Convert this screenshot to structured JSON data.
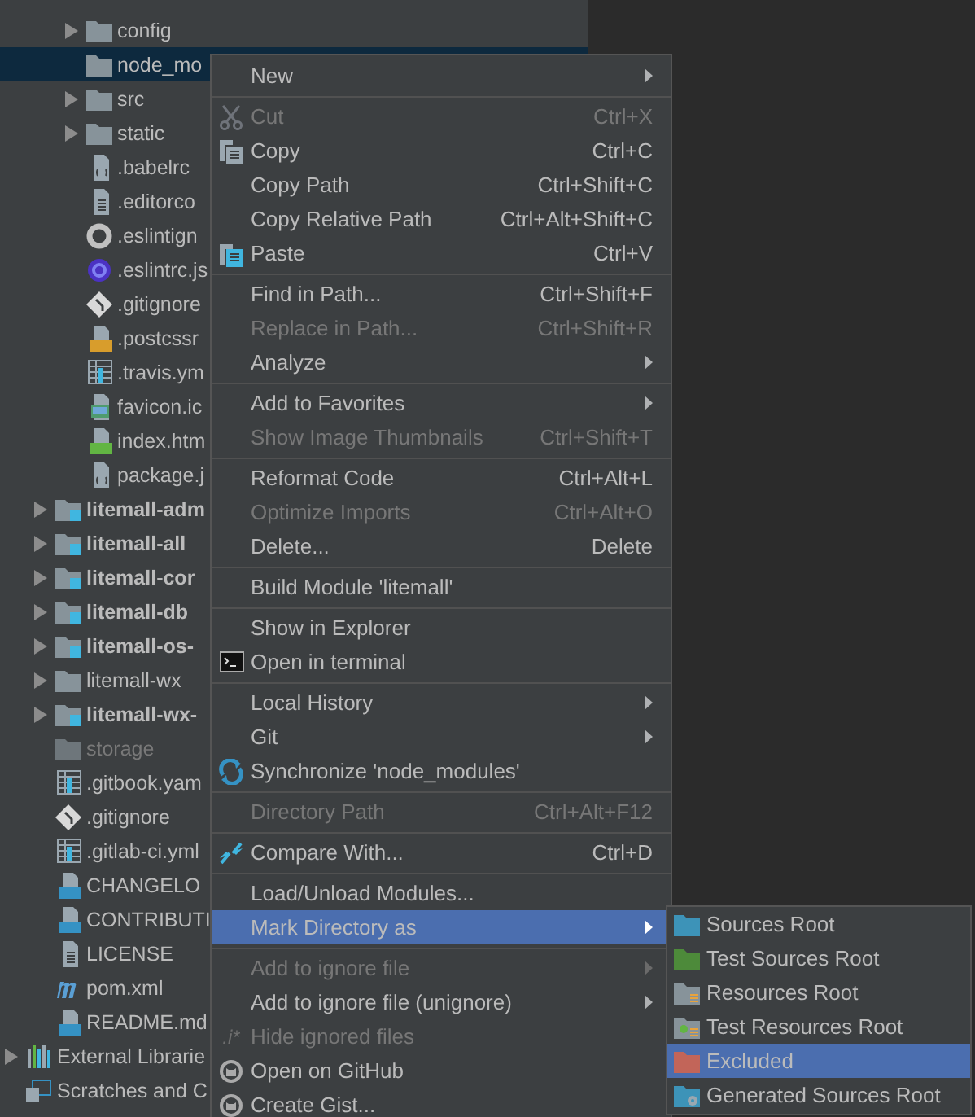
{
  "project_tree": [
    {
      "label": "config",
      "kind": "folder",
      "collapsed": true,
      "selected": false
    },
    {
      "label": "node_mo",
      "kind": "folder",
      "collapsed": false,
      "selected": true
    },
    {
      "label": "src",
      "kind": "folder",
      "collapsed": true,
      "selected": false
    },
    {
      "label": "static",
      "kind": "folder",
      "collapsed": true,
      "selected": false
    },
    {
      "label": ".babelrc",
      "kind": "babel",
      "collapsed": false,
      "selected": false
    },
    {
      "label": ".editorco",
      "kind": "text",
      "collapsed": false,
      "selected": false
    },
    {
      "label": ".eslintign",
      "kind": "ignore",
      "collapsed": false,
      "selected": false
    },
    {
      "label": ".eslintrc.js",
      "kind": "eslint",
      "collapsed": false,
      "selected": false
    },
    {
      "label": ".gitignore",
      "kind": "git",
      "collapsed": false,
      "selected": false
    },
    {
      "label": ".postcssr",
      "kind": "js",
      "collapsed": false,
      "selected": false
    },
    {
      "label": ".travis.ym",
      "kind": "table",
      "collapsed": false,
      "selected": false
    },
    {
      "label": "favicon.ic",
      "kind": "image",
      "collapsed": false,
      "selected": false
    },
    {
      "label": "index.htm",
      "kind": "html",
      "collapsed": false,
      "selected": false
    },
    {
      "label": "package.j",
      "kind": "json",
      "collapsed": false,
      "selected": false
    }
  ],
  "modules": [
    {
      "label": "litemall-adm",
      "kind": "module",
      "collapsed": true,
      "selected": false
    },
    {
      "label": "litemall-all",
      "kind": "module",
      "collapsed": true,
      "selected": false
    },
    {
      "label": "litemall-cor",
      "kind": "module",
      "collapsed": true,
      "selected": false
    },
    {
      "label": "litemall-db",
      "kind": "module",
      "collapsed": true,
      "selected": false
    },
    {
      "label": "litemall-os-",
      "kind": "module",
      "collapsed": true,
      "selected": false
    },
    {
      "label": "litemall-wx",
      "kind": "folder",
      "collapsed": true,
      "selected": false
    },
    {
      "label": "litemall-wx-",
      "kind": "module",
      "collapsed": true,
      "selected": false
    },
    {
      "label": "storage",
      "kind": "excluded",
      "collapsed": false,
      "selected": false
    },
    {
      "label": ".gitbook.yam",
      "kind": "table",
      "collapsed": false,
      "selected": false
    },
    {
      "label": ".gitignore",
      "kind": "git",
      "collapsed": false,
      "selected": false
    },
    {
      "label": ".gitlab-ci.yml",
      "kind": "table",
      "collapsed": false,
      "selected": false
    },
    {
      "label": "CHANGELO",
      "kind": "md",
      "collapsed": false,
      "selected": false
    },
    {
      "label": "CONTRIBUTI",
      "kind": "md",
      "collapsed": false,
      "selected": false
    },
    {
      "label": "LICENSE",
      "kind": "text",
      "collapsed": false,
      "selected": false
    },
    {
      "label": "pom.xml",
      "kind": "maven",
      "collapsed": false,
      "selected": false
    },
    {
      "label": "README.md",
      "kind": "md",
      "collapsed": false,
      "selected": false
    }
  ],
  "roots": [
    {
      "label": "External Librarie",
      "kind": "libraries",
      "collapsed": true,
      "selected": false
    },
    {
      "label": "Scratches and C",
      "kind": "scratches",
      "collapsed": false,
      "selected": false
    }
  ],
  "context_menu": [
    [
      {
        "label": "New",
        "submenu": true,
        "selected": false
      }
    ],
    [
      {
        "label": "Cut",
        "shortcut": "Ctrl+X",
        "kind": "scissors",
        "disabled": true,
        "selected": false
      },
      {
        "label": "Copy",
        "shortcut": "Ctrl+C",
        "kind": "copy",
        "disabled": false,
        "selected": false
      },
      {
        "label": "Copy Path",
        "shortcut": "Ctrl+Shift+C",
        "disabled": false,
        "selected": false
      },
      {
        "label": "Copy Relative Path",
        "shortcut": "Ctrl+Alt+Shift+C",
        "disabled": false,
        "selected": false
      },
      {
        "label": "Paste",
        "shortcut": "Ctrl+V",
        "kind": "paste",
        "disabled": false,
        "selected": false
      }
    ],
    [
      {
        "label": "Find in Path...",
        "shortcut": "Ctrl+Shift+F",
        "disabled": false,
        "selected": false
      },
      {
        "label": "Replace in Path...",
        "shortcut": "Ctrl+Shift+R",
        "disabled": true,
        "selected": false
      },
      {
        "label": "Analyze",
        "submenu": true,
        "disabled": false,
        "selected": false
      }
    ],
    [
      {
        "label": "Add to Favorites",
        "submenu": true,
        "disabled": false,
        "selected": false
      },
      {
        "label": "Show Image Thumbnails",
        "shortcut": "Ctrl+Shift+T",
        "disabled": true,
        "selected": false
      }
    ],
    [
      {
        "label": "Reformat Code",
        "shortcut": "Ctrl+Alt+L",
        "disabled": false,
        "selected": false
      },
      {
        "label": "Optimize Imports",
        "shortcut": "Ctrl+Alt+O",
        "disabled": true,
        "selected": false
      },
      {
        "label": "Delete...",
        "shortcut": "Delete",
        "disabled": false,
        "selected": false
      }
    ],
    [
      {
        "label": "Build Module 'litemall'",
        "disabled": false,
        "selected": false
      }
    ],
    [
      {
        "label": "Show in Explorer",
        "disabled": false,
        "selected": false
      },
      {
        "label": "Open in terminal",
        "kind": "terminal",
        "disabled": false,
        "selected": false
      }
    ],
    [
      {
        "label": "Local History",
        "submenu": true,
        "disabled": false,
        "selected": false
      },
      {
        "label": "Git",
        "submenu": true,
        "disabled": false,
        "selected": false
      },
      {
        "label": "Synchronize 'node_modules'",
        "kind": "sync",
        "disabled": false,
        "selected": false
      }
    ],
    [
      {
        "label": "Directory Path",
        "shortcut": "Ctrl+Alt+F12",
        "disabled": true,
        "selected": false
      }
    ],
    [
      {
        "label": "Compare With...",
        "shortcut": "Ctrl+D",
        "kind": "compare",
        "disabled": false,
        "selected": false
      }
    ],
    [
      {
        "label": "Load/Unload Modules...",
        "disabled": false,
        "selected": false
      },
      {
        "label": "Mark Directory as",
        "submenu": true,
        "disabled": false,
        "selected": true
      }
    ],
    [
      {
        "label": "Add to ignore file",
        "submenu": true,
        "disabled": true,
        "selected": false
      },
      {
        "label": "Add to ignore file (unignore)",
        "submenu": true,
        "disabled": false,
        "selected": false
      },
      {
        "label": "Hide ignored files",
        "glyph": ".i*",
        "disabled": true,
        "selected": false
      },
      {
        "label": "Open on GitHub",
        "kind": "octo",
        "disabled": false,
        "selected": false
      },
      {
        "label": "Create Gist...",
        "kind": "octo",
        "disabled": false,
        "selected": false
      }
    ]
  ],
  "mark_directory_submenu": [
    {
      "label": "Sources Root",
      "kind": "sources",
      "selected": false
    },
    {
      "label": "Test Sources Root",
      "kind": "test-sources",
      "selected": false
    },
    {
      "label": "Resources Root",
      "kind": "resources",
      "selected": false
    },
    {
      "label": "Test Resources Root",
      "kind": "test-resources",
      "selected": false
    },
    {
      "label": "Excluded",
      "kind": "excluded-root",
      "selected": true
    },
    {
      "label": "Generated Sources Root",
      "kind": "generated",
      "selected": false
    }
  ]
}
